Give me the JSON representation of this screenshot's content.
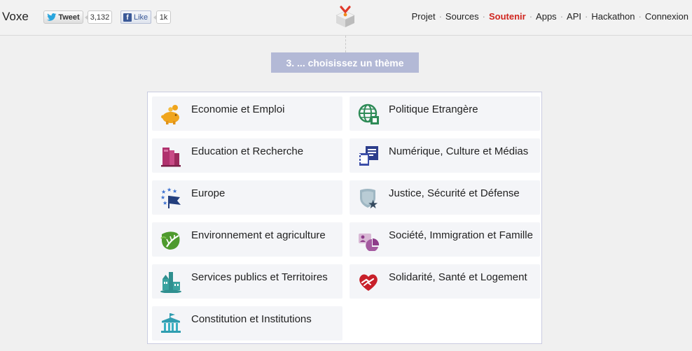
{
  "header": {
    "brand": "Voxe",
    "tweet_label": "Tweet",
    "tweet_count": "3,132",
    "like_label": "Like",
    "like_count": "1k",
    "nav": [
      {
        "label": "Projet"
      },
      {
        "label": "Sources"
      },
      {
        "label": "Soutenir",
        "active": true
      },
      {
        "label": "Apps"
      },
      {
        "label": "API"
      },
      {
        "label": "Hackathon"
      },
      {
        "label": "Connexion"
      }
    ]
  },
  "step_title": "3. ... choisissez un thème",
  "themes": [
    {
      "label": "Economie et Emploi",
      "icon": "piggy-bank-icon"
    },
    {
      "label": "Politique Etrangère",
      "icon": "globe-icon"
    },
    {
      "label": "Education et Recherche",
      "icon": "books-icon"
    },
    {
      "label": "Numérique, Culture et Médias",
      "icon": "media-icon"
    },
    {
      "label": "Europe",
      "icon": "eu-flag-icon"
    },
    {
      "label": "Justice, Sécurité et Défense",
      "icon": "shield-icon"
    },
    {
      "label": "Environnement et agriculture",
      "icon": "leaf-icon"
    },
    {
      "label": "Société, Immigration et Famille",
      "icon": "society-icon"
    },
    {
      "label": "Services publics et Territoires",
      "icon": "city-icon"
    },
    {
      "label": "Solidarité, Santé et Logement",
      "icon": "heart-hands-icon"
    },
    {
      "label": "Constitution et Institutions",
      "icon": "institution-icon"
    }
  ],
  "colors": {
    "accent_red": "#d0261f",
    "step_bg": "#b3b9d6",
    "card_bg": "#f4f5f8"
  }
}
